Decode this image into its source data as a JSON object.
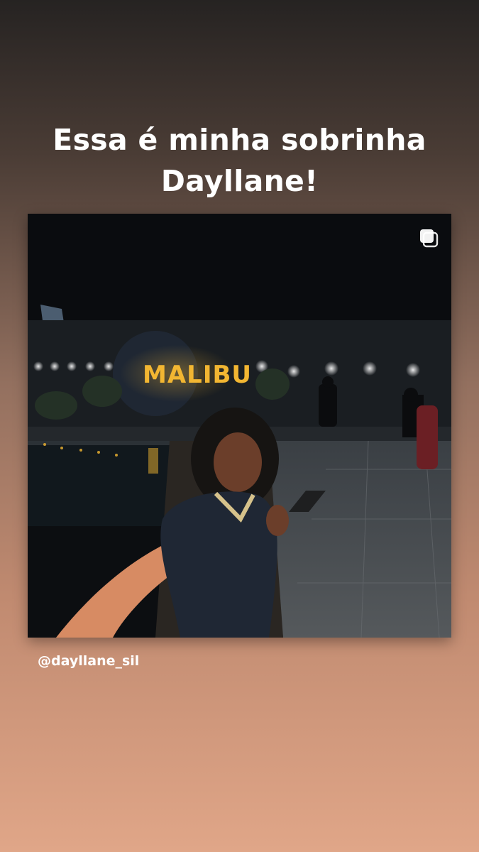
{
  "story": {
    "caption_line1": "Essa é minha sobrinha",
    "caption_line2": "Dayllane!",
    "mention": "@dayllane_sil"
  },
  "post": {
    "sign_text": "MALIBU",
    "multi_icon": "multiple-photos-icon"
  },
  "colors": {
    "background_top": "#262322",
    "background_bottom": "#e0a688",
    "neon_sign": "#f2b632"
  }
}
